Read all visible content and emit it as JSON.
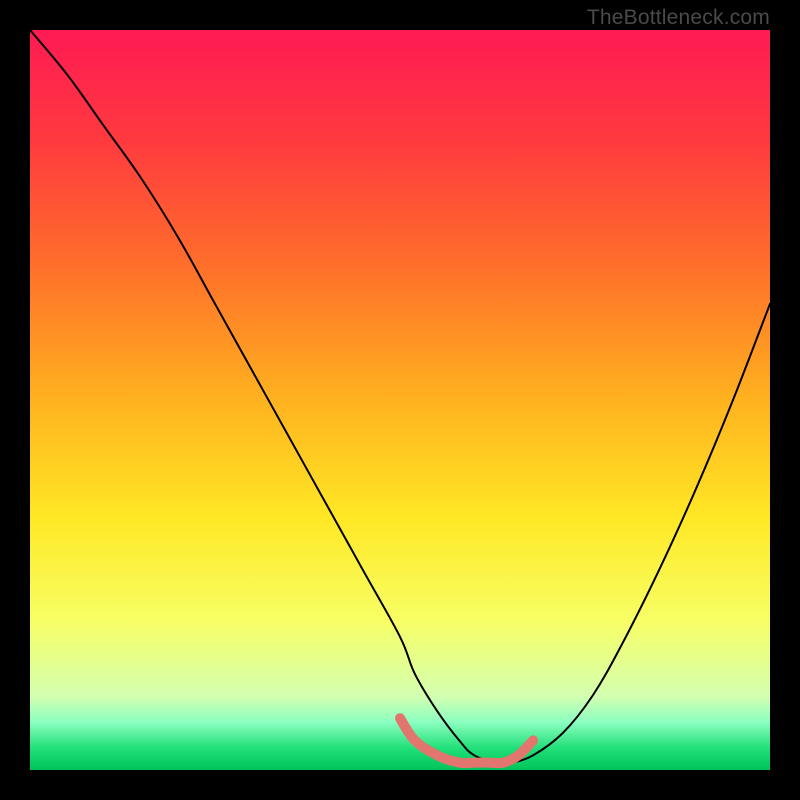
{
  "watermark": "TheBottleneck.com",
  "chart_data": {
    "type": "line",
    "title": "",
    "xlabel": "",
    "ylabel": "",
    "xlim": [
      0,
      100
    ],
    "ylim": [
      0,
      100
    ],
    "gradient_stops": [
      {
        "offset": 0,
        "color": "#ff1a54"
      },
      {
        "offset": 0.15,
        "color": "#ff3a3f"
      },
      {
        "offset": 0.32,
        "color": "#ff6f2a"
      },
      {
        "offset": 0.5,
        "color": "#ffb21f"
      },
      {
        "offset": 0.66,
        "color": "#ffe825"
      },
      {
        "offset": 0.8,
        "color": "#f7ff66"
      },
      {
        "offset": 0.9,
        "color": "#d4ffb0"
      },
      {
        "offset": 0.935,
        "color": "#8cffc0"
      },
      {
        "offset": 0.97,
        "color": "#22e07a"
      },
      {
        "offset": 1.0,
        "color": "#00c45a"
      }
    ],
    "series": [
      {
        "name": "bottleneck-curve",
        "color": "#000000",
        "x": [
          0,
          5,
          10,
          15,
          20,
          25,
          30,
          35,
          40,
          45,
          50,
          52,
          55,
          58,
          60,
          63,
          65,
          68,
          72,
          76,
          80,
          85,
          90,
          95,
          100
        ],
        "y": [
          100,
          94,
          87,
          80,
          72,
          63,
          54,
          45,
          36,
          27,
          18,
          13,
          8,
          4,
          2,
          1,
          1,
          2,
          5,
          10,
          17,
          27,
          38,
          50,
          63
        ]
      },
      {
        "name": "valley-highlight",
        "color": "#e2766f",
        "x": [
          50,
          52,
          55,
          58,
          60,
          62,
          64,
          66,
          68
        ],
        "y": [
          7,
          4,
          2,
          1,
          1,
          1,
          1,
          2,
          4
        ]
      }
    ]
  }
}
